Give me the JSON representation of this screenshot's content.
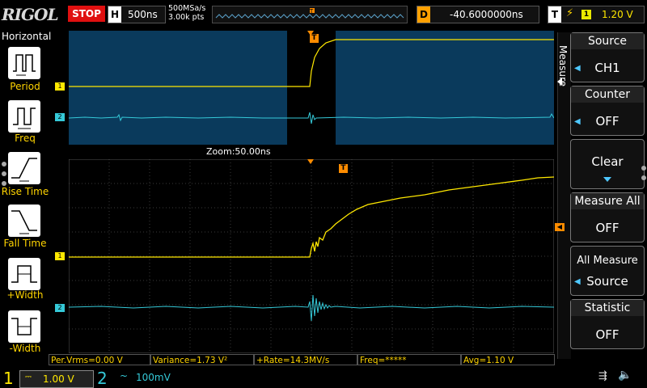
{
  "top": {
    "logo": "RIGOL",
    "run_state": "STOP",
    "horizontal_label": "H",
    "timebase": "500ns",
    "sample_rate": "500MSa/s",
    "mem_depth": "3.00k pts",
    "delay_label": "D",
    "delay": "-40.6000000ns",
    "trigger_label": "T",
    "trigger_source": "1",
    "trigger_level": "1.20 V"
  },
  "left_panel": {
    "title": "Horizontal",
    "items": [
      {
        "label": "Period",
        "icon": "period-icon"
      },
      {
        "label": "Freq",
        "icon": "freq-icon"
      },
      {
        "label": "Rise Time",
        "icon": "rise-time-icon"
      },
      {
        "label": "Fall Time",
        "icon": "fall-time-icon"
      },
      {
        "label": "+Width",
        "icon": "pos-width-icon"
      },
      {
        "label": "-Width",
        "icon": "neg-width-icon"
      }
    ]
  },
  "right_panel": {
    "tab_label": "Measure",
    "items": [
      {
        "title": "Source",
        "value": "CH1"
      },
      {
        "title": "Counter",
        "value": "OFF"
      },
      {
        "title": "",
        "value": "Clear"
      },
      {
        "title": "Measure All",
        "value": "OFF"
      },
      {
        "title": "All Measure",
        "value": "Source"
      },
      {
        "title": "Statistic",
        "value": "OFF"
      }
    ]
  },
  "zoom": {
    "label": "Zoom:50.00ns"
  },
  "markers": {
    "ch1": "1",
    "ch2": "2",
    "trigger": "T"
  },
  "measurements": [
    {
      "text": "Per.Vrms=0.00 V"
    },
    {
      "text": "Variance=1.73 V²"
    },
    {
      "text": "+Rate=14.3MV/s"
    },
    {
      "text": "Freq=*****"
    },
    {
      "text": "Avg=1.10 V"
    }
  ],
  "bottom": {
    "ch1_num": "1",
    "ch1_coupling": "⎓",
    "ch1_scale": "1.00 V",
    "ch2_num": "2",
    "ch2_coupling": "~",
    "ch2_scale": "100mV"
  },
  "colors": {
    "ch1": "#ffe800",
    "ch2": "#35c9d8",
    "trigger": "#ff8c00",
    "stop": "#e01010"
  }
}
